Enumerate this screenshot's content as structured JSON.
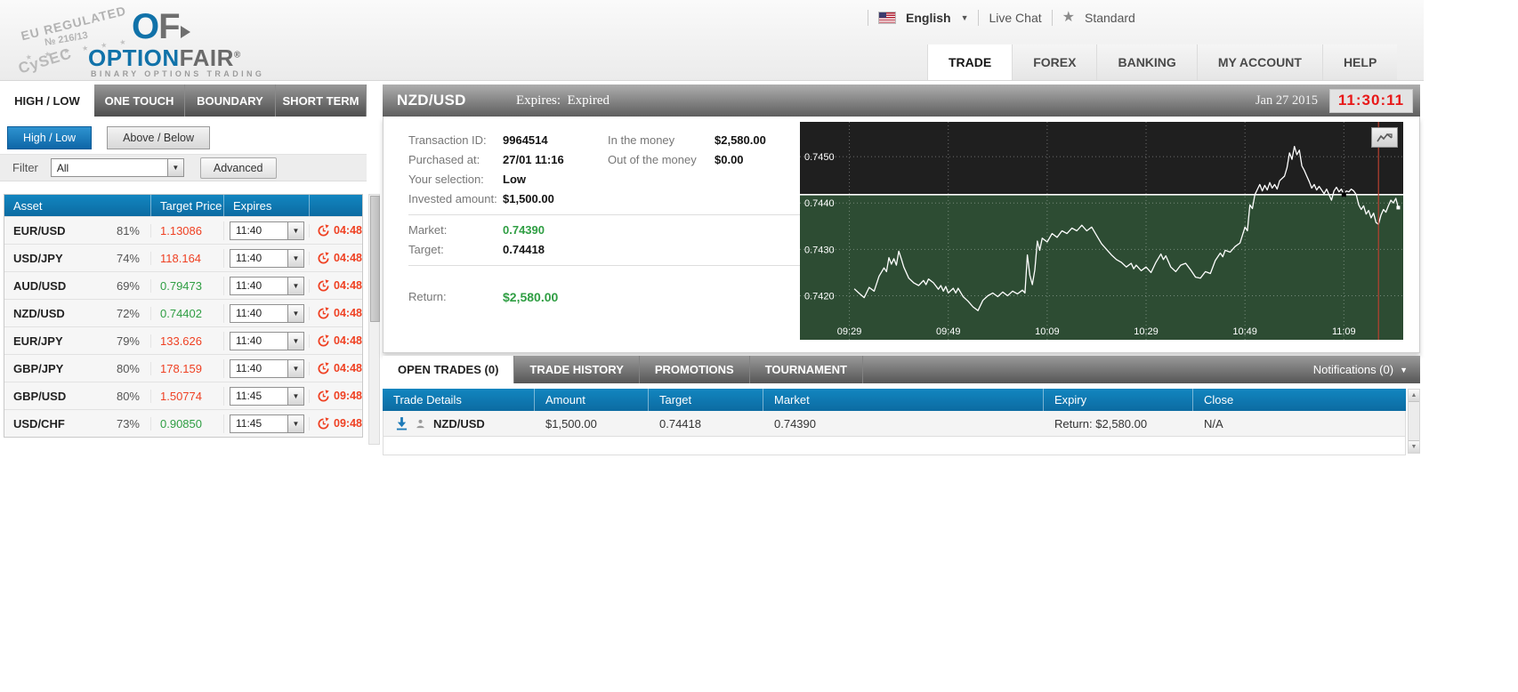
{
  "header": {
    "stamp": {
      "line1": "EU REGULATED",
      "line2": "№ 216/13",
      "line3": "CySEC"
    },
    "logo": {
      "monogram_o": "O",
      "monogram_f": "F",
      "brand_blue": "OPTION",
      "brand_gray": "FAIR",
      "registered": "®",
      "tagline": "BINARY OPTIONS TRADING"
    },
    "language": "English",
    "live_chat": "Live Chat",
    "account_tier": "Standard",
    "nav": [
      {
        "label": "TRADE"
      },
      {
        "label": "FOREX"
      },
      {
        "label": "BANKING"
      },
      {
        "label": "MY ACCOUNT"
      },
      {
        "label": "HELP"
      }
    ]
  },
  "sidebar": {
    "tabs": [
      {
        "label": "HIGH / LOW"
      },
      {
        "label": "ONE TOUCH"
      },
      {
        "label": "BOUNDARY"
      },
      {
        "label": "SHORT TERM"
      }
    ],
    "mode_buttons": [
      {
        "label": "High / Low"
      },
      {
        "label": "Above / Below"
      }
    ],
    "filter": {
      "label": "Filter",
      "selected": "All",
      "advanced_label": "Advanced"
    },
    "asset_table": {
      "columns": [
        "Asset",
        "Target Price",
        "Expires"
      ],
      "rows": [
        {
          "asset": "EUR/USD",
          "payout": "81%",
          "price": "1.13086",
          "direction": "down",
          "expiry": "11:40",
          "countdown": "04:48"
        },
        {
          "asset": "USD/JPY",
          "payout": "74%",
          "price": "118.164",
          "direction": "down",
          "expiry": "11:40",
          "countdown": "04:48"
        },
        {
          "asset": "AUD/USD",
          "payout": "69%",
          "price": "0.79473",
          "direction": "up",
          "expiry": "11:40",
          "countdown": "04:48"
        },
        {
          "asset": "NZD/USD",
          "payout": "72%",
          "price": "0.74402",
          "direction": "up",
          "expiry": "11:40",
          "countdown": "04:48"
        },
        {
          "asset": "EUR/JPY",
          "payout": "79%",
          "price": "133.626",
          "direction": "down",
          "expiry": "11:40",
          "countdown": "04:48"
        },
        {
          "asset": "GBP/JPY",
          "payout": "80%",
          "price": "178.159",
          "direction": "down",
          "expiry": "11:40",
          "countdown": "04:48"
        },
        {
          "asset": "GBP/USD",
          "payout": "80%",
          "price": "1.50774",
          "direction": "down",
          "expiry": "11:45",
          "countdown": "09:48"
        },
        {
          "asset": "USD/CHF",
          "payout": "73%",
          "price": "0.90850",
          "direction": "up",
          "expiry": "11:45",
          "countdown": "09:48"
        }
      ]
    }
  },
  "trade_panel": {
    "title": "NZD/USD",
    "expires_label": "Expires:",
    "expires_value": "Expired",
    "date": "Jan 27 2015",
    "clock": "11:30:11",
    "details": {
      "col1": [
        {
          "label": "Transaction ID:",
          "value": "9964514"
        },
        {
          "label": "Purchased at:",
          "value": "27/01 11:16"
        },
        {
          "label": "Your selection:",
          "value": "Low"
        },
        {
          "label": "Invested amount:",
          "value": "$1,500.00"
        }
      ],
      "col2": [
        {
          "label": "In the money",
          "value": "$2,580.00"
        },
        {
          "label": "Out of the money",
          "value": "$0.00"
        }
      ],
      "market_label": "Market:",
      "market_value": "0.74390",
      "target_label": "Target:",
      "target_value": "0.74418",
      "return_label": "Return:",
      "return_value": "$2,580.00"
    }
  },
  "chart_data": {
    "type": "line",
    "title": "NZD/USD intraday price",
    "x_ticks": [
      "09:29",
      "09:49",
      "10:09",
      "10:29",
      "10:49",
      "11:09"
    ],
    "x_tick_minutes": [
      10,
      30,
      50,
      70,
      90,
      110
    ],
    "x_domain_minutes": [
      0,
      122
    ],
    "y_ticks": [
      0.745,
      0.744,
      0.743,
      0.742
    ],
    "ylim": [
      0.74105,
      0.74575
    ],
    "target_line": 0.74418,
    "expiry_line_minute": 117,
    "marker": {
      "minute": 110,
      "price": 0.74418
    },
    "grid": true,
    "legend_position": "none",
    "series": [
      {
        "name": "NZD/USD",
        "points": [
          [
            11,
            0.74215
          ],
          [
            12,
            0.74205
          ],
          [
            13,
            0.74196
          ],
          [
            14,
            0.74218
          ],
          [
            15,
            0.7421
          ],
          [
            16,
            0.74242
          ],
          [
            17,
            0.7426
          ],
          [
            17.5,
            0.74252
          ],
          [
            18,
            0.74282
          ],
          [
            18.5,
            0.74268
          ],
          [
            19,
            0.7428
          ],
          [
            19.5,
            0.74266
          ],
          [
            20,
            0.74296
          ],
          [
            20.5,
            0.7428
          ],
          [
            21,
            0.74262
          ],
          [
            22,
            0.74238
          ],
          [
            23,
            0.74228
          ],
          [
            24,
            0.74222
          ],
          [
            25,
            0.74233
          ],
          [
            25.5,
            0.74224
          ],
          [
            26,
            0.74236
          ],
          [
            27,
            0.74228
          ],
          [
            28,
            0.74214
          ],
          [
            28.5,
            0.74222
          ],
          [
            29,
            0.7421
          ],
          [
            29.5,
            0.7422
          ],
          [
            30,
            0.74206
          ],
          [
            31,
            0.74216
          ],
          [
            31.5,
            0.74206
          ],
          [
            32,
            0.74216
          ],
          [
            33,
            0.74198
          ],
          [
            34,
            0.74188
          ],
          [
            35,
            0.74176
          ],
          [
            36,
            0.74168
          ],
          [
            37,
            0.7419
          ],
          [
            38,
            0.742
          ],
          [
            39,
            0.74206
          ],
          [
            40,
            0.74198
          ],
          [
            41,
            0.74208
          ],
          [
            42,
            0.742
          ],
          [
            43,
            0.7421
          ],
          [
            44,
            0.74204
          ],
          [
            45,
            0.74212
          ],
          [
            45.5,
            0.74206
          ],
          [
            46,
            0.74288
          ],
          [
            46.5,
            0.74244
          ],
          [
            47,
            0.74224
          ],
          [
            47.5,
            0.74256
          ],
          [
            48,
            0.74318
          ],
          [
            48.5,
            0.74298
          ],
          [
            49,
            0.74324
          ],
          [
            50,
            0.74316
          ],
          [
            51,
            0.74334
          ],
          [
            52,
            0.74326
          ],
          [
            53,
            0.7434
          ],
          [
            54,
            0.74334
          ],
          [
            55,
            0.74346
          ],
          [
            56,
            0.7434
          ],
          [
            57,
            0.74352
          ],
          [
            58,
            0.7434
          ],
          [
            59,
            0.74348
          ],
          [
            60,
            0.7433
          ],
          [
            61,
            0.74312
          ],
          [
            62,
            0.743
          ],
          [
            63,
            0.74288
          ],
          [
            64,
            0.74278
          ],
          [
            65,
            0.74272
          ],
          [
            66,
            0.74262
          ],
          [
            67,
            0.7427
          ],
          [
            67.5,
            0.74258
          ],
          [
            68,
            0.74266
          ],
          [
            69,
            0.74254
          ],
          [
            70,
            0.74262
          ],
          [
            71,
            0.7425
          ],
          [
            72,
            0.74272
          ],
          [
            73,
            0.7429
          ],
          [
            73.5,
            0.74278
          ],
          [
            74,
            0.74286
          ],
          [
            75,
            0.74262
          ],
          [
            76,
            0.74252
          ],
          [
            77,
            0.74266
          ],
          [
            78,
            0.7427
          ],
          [
            79,
            0.74256
          ],
          [
            80,
            0.7424
          ],
          [
            81,
            0.74238
          ],
          [
            82,
            0.74252
          ],
          [
            83,
            0.74248
          ],
          [
            84,
            0.74276
          ],
          [
            85,
            0.74292
          ],
          [
            85.5,
            0.74284
          ],
          [
            86,
            0.74298
          ],
          [
            87,
            0.74294
          ],
          [
            88,
            0.74306
          ],
          [
            89,
            0.74314
          ],
          [
            90,
            0.74348
          ],
          [
            90.5,
            0.7434
          ],
          [
            91,
            0.74396
          ],
          [
            91.5,
            0.74388
          ],
          [
            92,
            0.74418
          ],
          [
            93,
            0.7444
          ],
          [
            93.5,
            0.74426
          ],
          [
            94,
            0.74438
          ],
          [
            94.5,
            0.74428
          ],
          [
            95,
            0.74444
          ],
          [
            95.5,
            0.74432
          ],
          [
            96,
            0.7444
          ],
          [
            96.5,
            0.7443
          ],
          [
            97,
            0.74448
          ],
          [
            98,
            0.74458
          ],
          [
            98.5,
            0.74476
          ],
          [
            99,
            0.74508
          ],
          [
            99.5,
            0.74494
          ],
          [
            100,
            0.74522
          ],
          [
            100.5,
            0.74504
          ],
          [
            101,
            0.74514
          ],
          [
            101.5,
            0.7448
          ],
          [
            102,
            0.7447
          ],
          [
            102.5,
            0.74458
          ],
          [
            103,
            0.74446
          ],
          [
            103.5,
            0.74432
          ],
          [
            104,
            0.7444
          ],
          [
            104.5,
            0.74428
          ],
          [
            105,
            0.74436
          ],
          [
            105.5,
            0.74428
          ],
          [
            106,
            0.7442
          ],
          [
            106.5,
            0.7443
          ],
          [
            107,
            0.74418
          ],
          [
            107.5,
            0.74406
          ],
          [
            108,
            0.74426
          ],
          [
            108.5,
            0.74434
          ],
          [
            109,
            0.74424
          ],
          [
            109.5,
            0.7443
          ],
          [
            110,
            0.74418
          ],
          [
            110.5,
            0.74426
          ],
          [
            111,
            0.74424
          ],
          [
            111.5,
            0.7443
          ],
          [
            112,
            0.74426
          ],
          [
            112.5,
            0.74418
          ],
          [
            113,
            0.74396
          ],
          [
            113.5,
            0.74386
          ],
          [
            114,
            0.74394
          ],
          [
            114.5,
            0.74376
          ],
          [
            115,
            0.74384
          ],
          [
            115.5,
            0.74368
          ],
          [
            116,
            0.74378
          ],
          [
            116.5,
            0.74358
          ],
          [
            117,
            0.74354
          ],
          [
            117.5,
            0.74374
          ],
          [
            118,
            0.74386
          ],
          [
            118.5,
            0.7438
          ],
          [
            119,
            0.74394
          ],
          [
            119.5,
            0.74406
          ],
          [
            120,
            0.744
          ],
          [
            120.5,
            0.7441
          ],
          [
            121,
            0.7439
          ]
        ]
      }
    ]
  },
  "bottom": {
    "tabs": [
      {
        "label": "OPEN TRADES (0)"
      },
      {
        "label": "TRADE HISTORY"
      },
      {
        "label": "PROMOTIONS"
      },
      {
        "label": "TOURNAMENT"
      }
    ],
    "notifications": "Notifications (0)",
    "trades_table": {
      "columns": [
        "Trade Details",
        "Amount",
        "Target",
        "Market",
        "Expiry",
        "Close"
      ],
      "rows": [
        {
          "asset": "NZD/USD",
          "amount": "$1,500.00",
          "target": "0.74418",
          "market": "0.74390",
          "expiry": "Return: $2,580.00",
          "close": "N/A"
        }
      ]
    }
  },
  "colors": {
    "accent_blue": "#0f76ad",
    "negative_red": "#ef4123",
    "positive_green": "#2f9e43",
    "clock_red": "#e81717",
    "chart_bg_above": "#1f1f1f",
    "chart_bg_below": "#2d4c33",
    "chart_line": "#ffffff",
    "expiry_line": "#b8402f"
  }
}
